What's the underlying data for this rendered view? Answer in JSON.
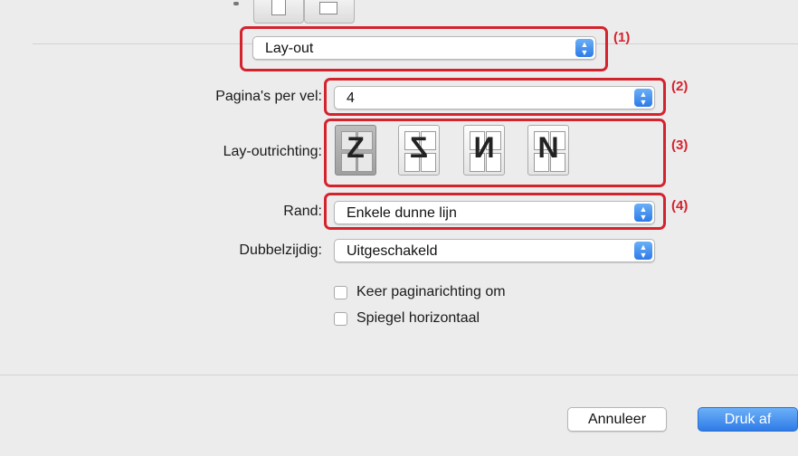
{
  "panel": {
    "select": "Lay-out"
  },
  "pages_per_sheet": {
    "label": "Pagina's per vel:",
    "value": "4"
  },
  "layout_direction": {
    "label": "Lay-outrichting:",
    "options": [
      "Z",
      "Z-reverse",
      "N-reverse",
      "N"
    ],
    "selected": 0
  },
  "border": {
    "label": "Rand:",
    "value": "Enkele dunne lijn"
  },
  "two_sided": {
    "label": "Dubbelzijdig:",
    "value": "Uitgeschakeld"
  },
  "checkboxes": {
    "reverse": {
      "label": "Keer paginarichting om",
      "checked": false
    },
    "flip": {
      "label": "Spiegel horizontaal",
      "checked": false
    }
  },
  "callouts": [
    "(1)",
    "(2)",
    "(3)",
    "(4)"
  ],
  "buttons": {
    "cancel": "Annuleer",
    "print": "Druk af"
  },
  "colors": {
    "accent": "#2f7be6",
    "callout": "#d5232e"
  }
}
